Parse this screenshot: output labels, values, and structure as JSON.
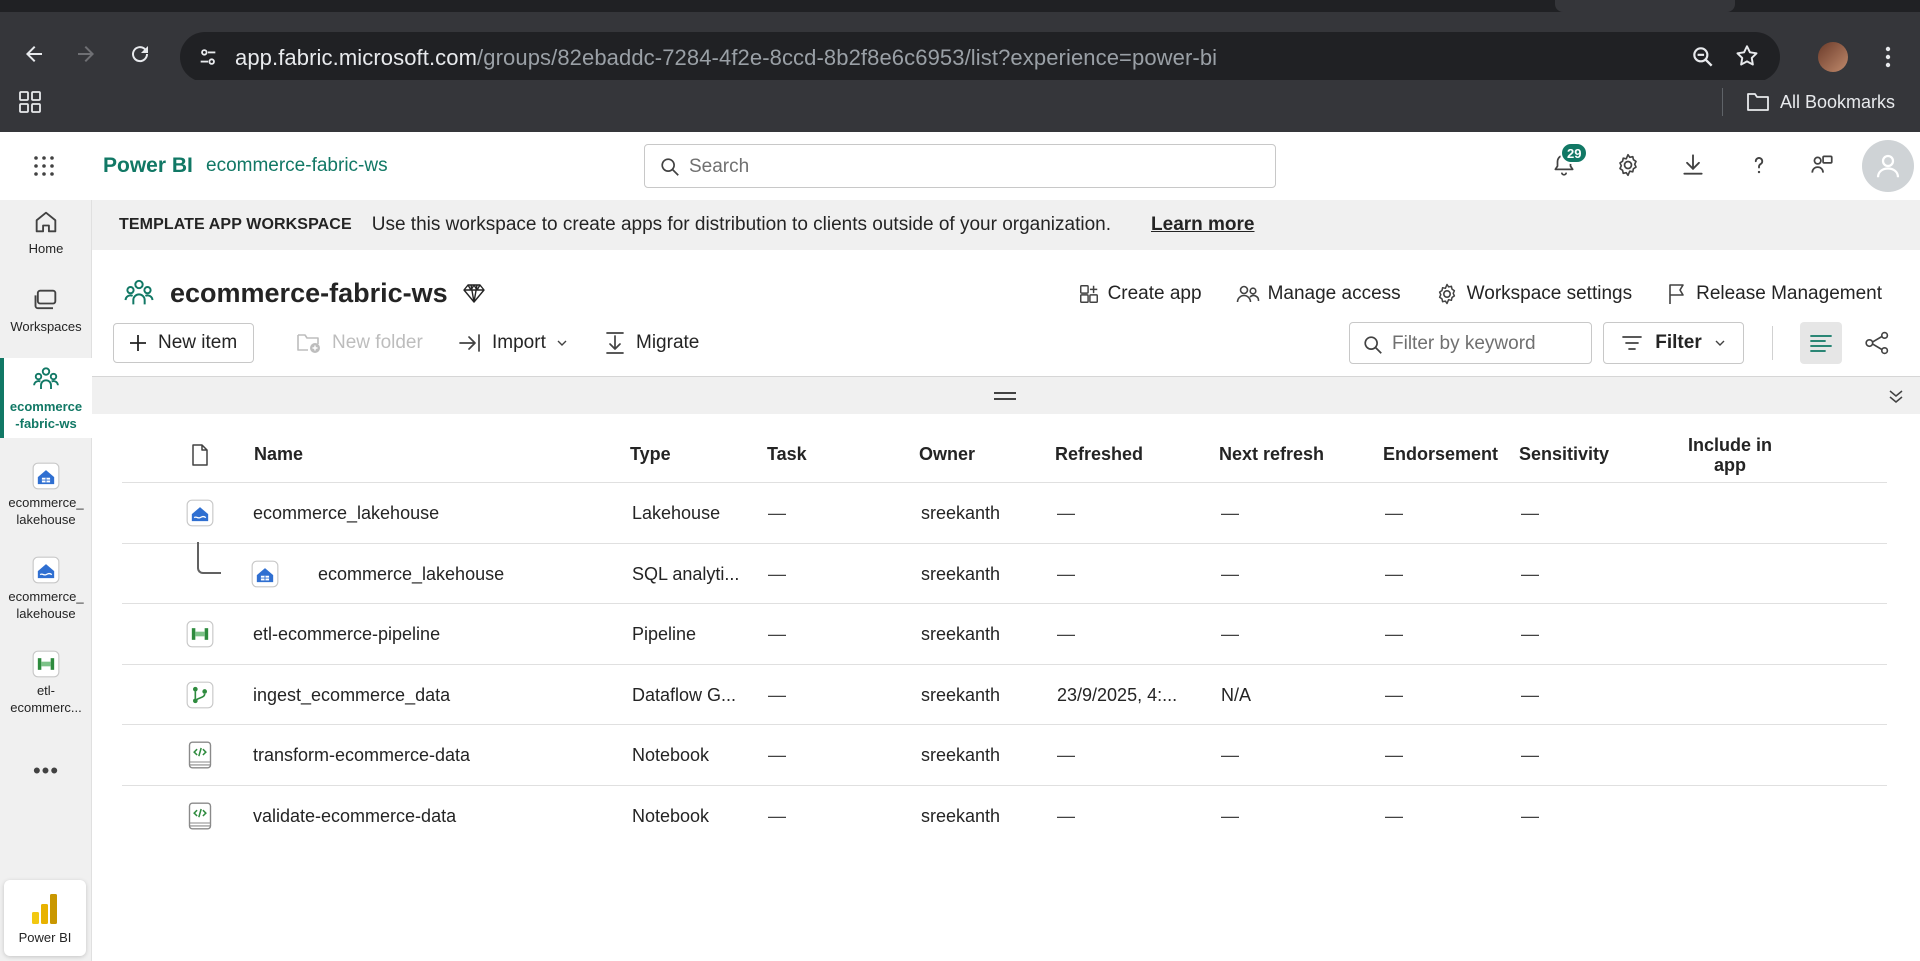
{
  "browser": {
    "url_host": "app.fabric.microsoft.com",
    "url_path": "/groups/82ebaddc-7284-4f2e-8ccd-8b2f8e6c6953/list?experience=power-bi",
    "all_bookmarks_label": "All Bookmarks"
  },
  "header": {
    "brand": "Power BI",
    "workspace_crumb": "ecommerce-fabric-ws",
    "search_placeholder": "Search",
    "notification_count": "29"
  },
  "rail": {
    "items": [
      {
        "label": "Home",
        "icon": "home-icon"
      },
      {
        "label": "Workspaces",
        "icon": "workspaces-icon"
      },
      {
        "label": "ecommerce\n-fabric-ws",
        "icon": "workspace-people-icon"
      },
      {
        "label": "ecommerce_\nlakehouse",
        "icon": "lakehouse-icon"
      },
      {
        "label": "ecommerce_\nlakehouse",
        "icon": "lakehouse-icon"
      },
      {
        "label": "etl-\necommerc...",
        "icon": "pipeline-icon"
      }
    ],
    "more_label": "•••",
    "bottom_label": "Power BI"
  },
  "banner": {
    "tag": "TEMPLATE APP WORKSPACE",
    "message": "Use this workspace to create apps for distribution to clients outside of your organization.",
    "learn_more": "Learn more"
  },
  "workspace": {
    "name": "ecommerce-fabric-ws",
    "actions": {
      "create_app": "Create app",
      "manage_access": "Manage access",
      "workspace_settings": "Workspace settings",
      "release_management": "Release Management"
    }
  },
  "commands": {
    "new_item": "New item",
    "new_folder": "New folder",
    "import": "Import",
    "migrate": "Migrate",
    "filter_placeholder": "Filter by keyword",
    "filter": "Filter"
  },
  "table": {
    "columns": {
      "name": "Name",
      "type": "Type",
      "task": "Task",
      "owner": "Owner",
      "refreshed": "Refreshed",
      "next_refresh": "Next refresh",
      "endorsement": "Endorsement",
      "sensitivity": "Sensitivity",
      "include_in_app": "Include in\napp"
    },
    "rows": [
      {
        "icon": "lakehouse-icon",
        "name": "ecommerce_lakehouse",
        "type": "Lakehouse",
        "task": "—",
        "owner": "sreekanth",
        "refreshed": "—",
        "next_refresh": "—",
        "endorsement": "—",
        "sensitivity": "—",
        "child": false
      },
      {
        "icon": "sql-endpoint-icon",
        "name": "ecommerce_lakehouse",
        "type": "SQL analyti...",
        "task": "—",
        "owner": "sreekanth",
        "refreshed": "—",
        "next_refresh": "—",
        "endorsement": "—",
        "sensitivity": "—",
        "child": true
      },
      {
        "icon": "pipeline-icon",
        "name": "etl-ecommerce-pipeline",
        "type": "Pipeline",
        "task": "—",
        "owner": "sreekanth",
        "refreshed": "—",
        "next_refresh": "—",
        "endorsement": "—",
        "sensitivity": "—",
        "child": false
      },
      {
        "icon": "dataflow-icon",
        "name": "ingest_ecommerce_data",
        "type": "Dataflow G...",
        "task": "—",
        "owner": "sreekanth",
        "refreshed": "23/9/2025, 4:...",
        "next_refresh": "N/A",
        "endorsement": "—",
        "sensitivity": "—",
        "child": false
      },
      {
        "icon": "notebook-icon",
        "name": "transform-ecommerce-data",
        "type": "Notebook",
        "task": "—",
        "owner": "sreekanth",
        "refreshed": "—",
        "next_refresh": "—",
        "endorsement": "—",
        "sensitivity": "—",
        "child": false
      },
      {
        "icon": "notebook-icon",
        "name": "validate-ecommerce-data",
        "type": "Notebook",
        "task": "—",
        "owner": "sreekanth",
        "refreshed": "—",
        "next_refresh": "—",
        "endorsement": "—",
        "sensitivity": "—",
        "child": false
      }
    ]
  },
  "colors": {
    "accent": "#117865",
    "lakehouse_blue": "#2f6fd1",
    "pipeline_green": "#2e8b3e"
  }
}
